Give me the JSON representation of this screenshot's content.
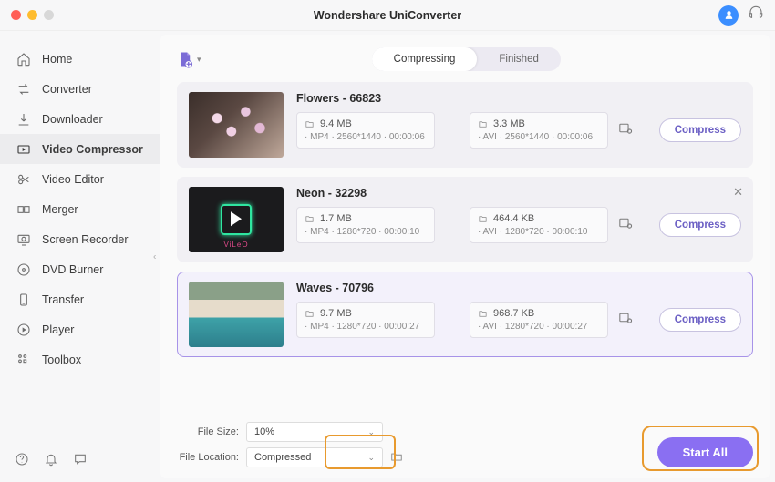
{
  "app_title": "Wondershare UniConverter",
  "sidebar": {
    "items": [
      {
        "label": "Home"
      },
      {
        "label": "Converter"
      },
      {
        "label": "Downloader"
      },
      {
        "label": "Video Compressor"
      },
      {
        "label": "Video Editor"
      },
      {
        "label": "Merger"
      },
      {
        "label": "Screen Recorder"
      },
      {
        "label": "DVD Burner"
      },
      {
        "label": "Transfer"
      },
      {
        "label": "Player"
      },
      {
        "label": "Toolbox"
      }
    ]
  },
  "tabs": {
    "compressing": "Compressing",
    "finished": "Finished"
  },
  "compress_btn": "Compress",
  "items": [
    {
      "title": "Flowers - 66823",
      "in": {
        "size": "9.4 MB",
        "meta": "· MP4  · 2560*1440  · 00:00:06"
      },
      "out": {
        "size": "3.3 MB",
        "meta": "· AVI  · 2560*1440  · 00:00:06"
      }
    },
    {
      "title": "Neon - 32298",
      "in": {
        "size": "1.7 MB",
        "meta": "· MP4  · 1280*720  · 00:00:10"
      },
      "out": {
        "size": "464.4 KB",
        "meta": "· AVI  · 1280*720  · 00:00:10"
      }
    },
    {
      "title": "Waves - 70796",
      "in": {
        "size": "9.7 MB",
        "meta": "· MP4  · 1280*720  · 00:00:27"
      },
      "out": {
        "size": "968.7 KB",
        "meta": "· AVI  · 1280*720  · 00:00:27"
      }
    }
  ],
  "bottom": {
    "file_size_label": "File Size:",
    "file_size_value": "10%",
    "file_location_label": "File Location:",
    "file_location_value": "Compressed",
    "start_all": "Start All"
  }
}
